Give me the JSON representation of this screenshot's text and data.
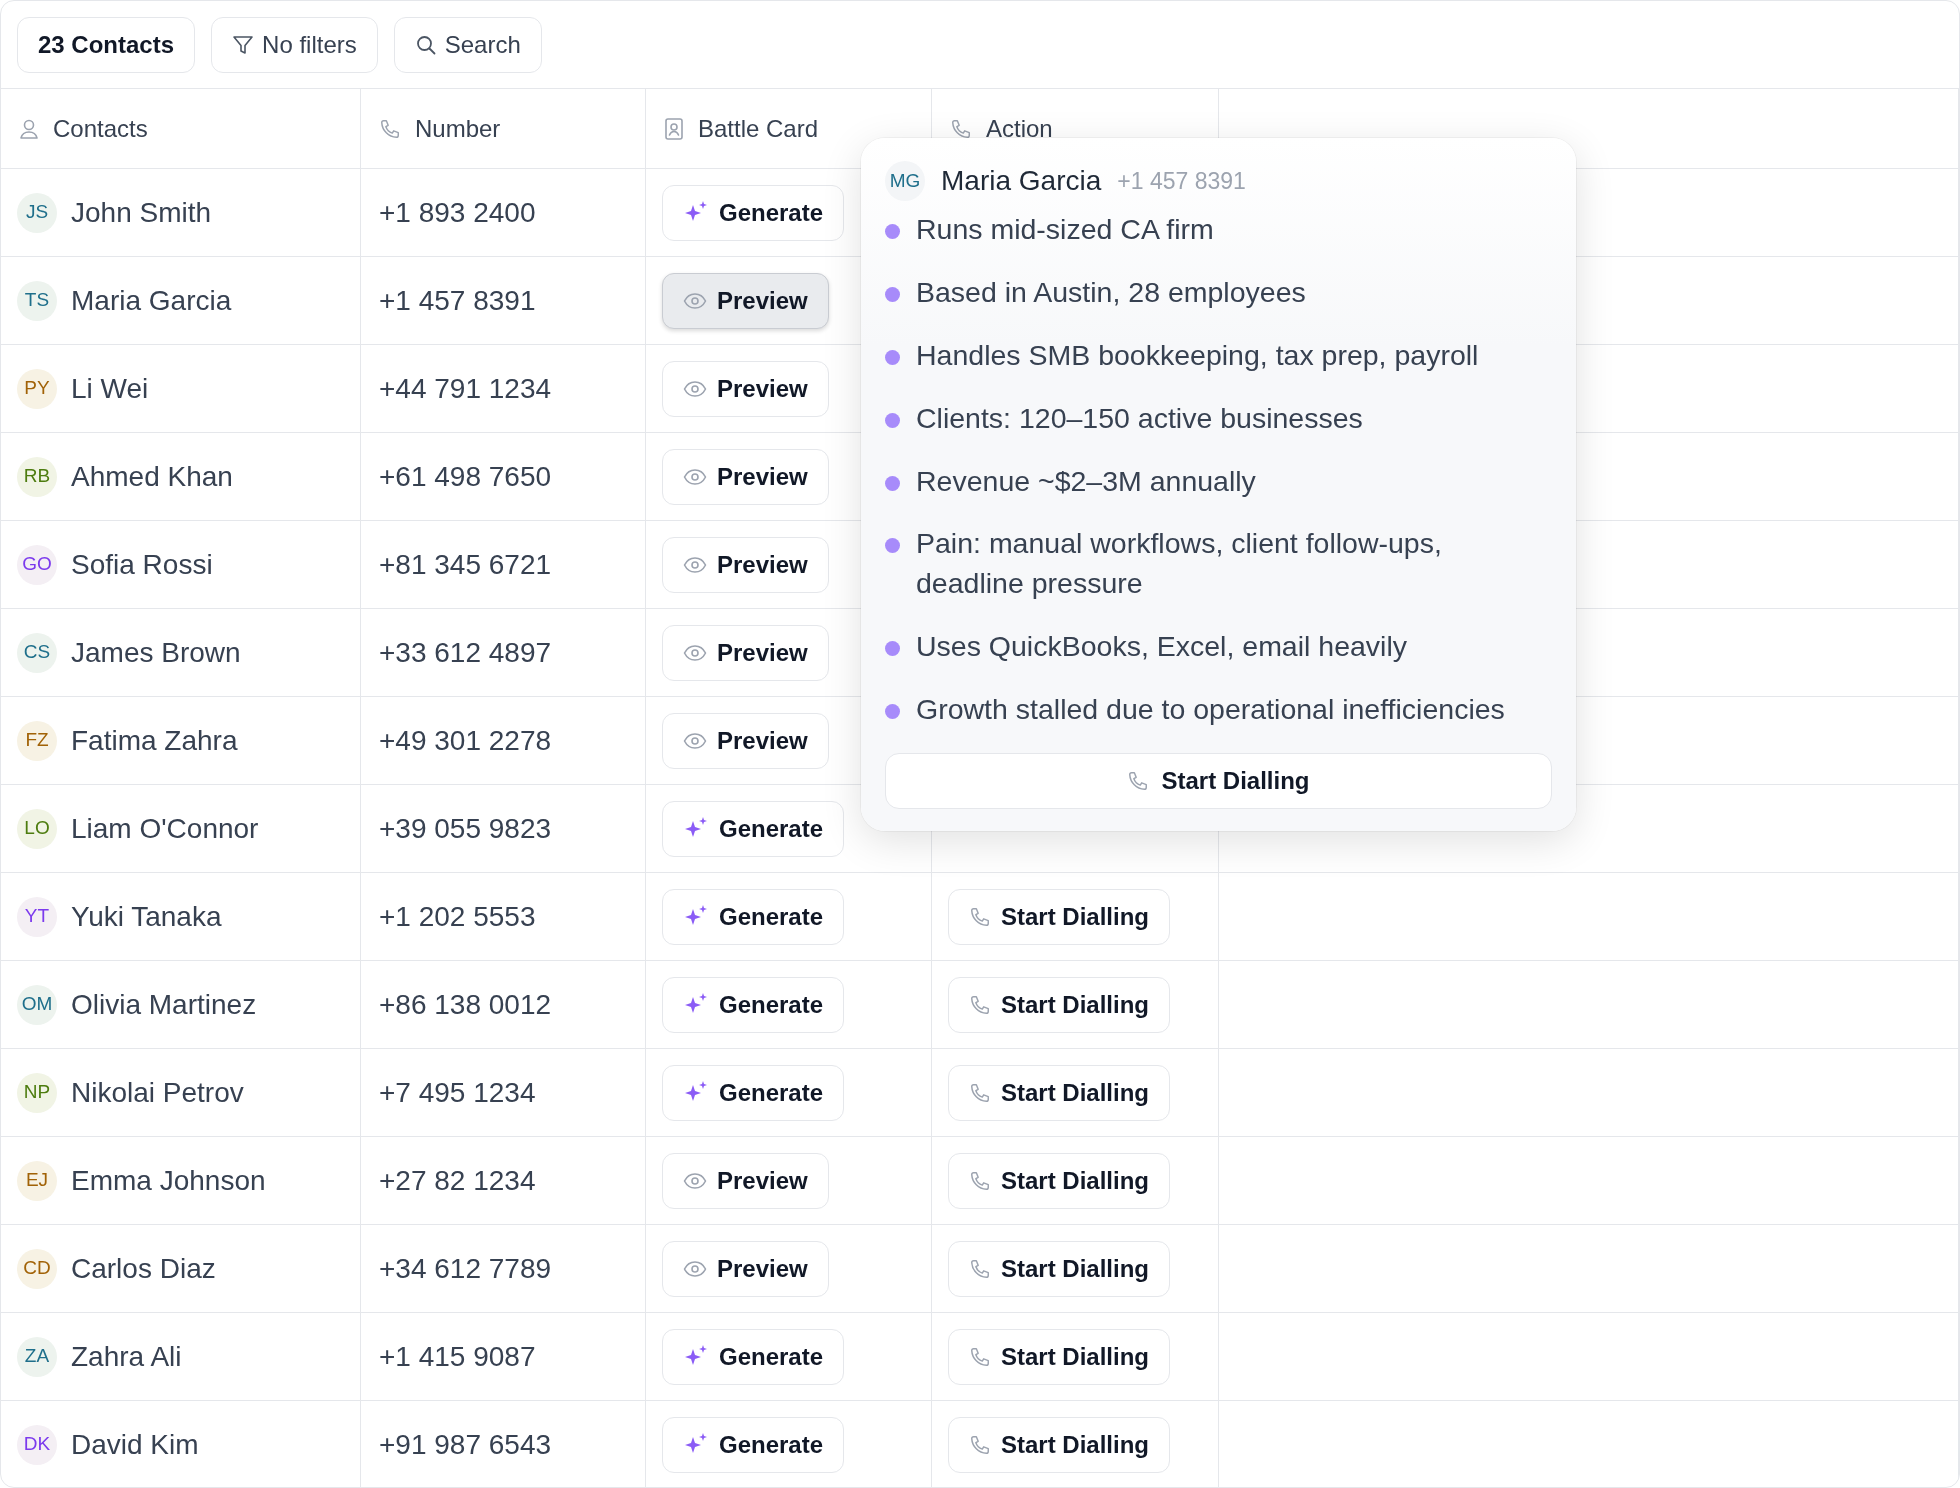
{
  "toolbar": {
    "count": "23 Contacts",
    "filters": "No filters",
    "search": "Search"
  },
  "table": {
    "columns": [
      {
        "label": "Contacts",
        "kind": "person"
      },
      {
        "label": "Number",
        "kind": "phone"
      },
      {
        "label": "Battle Card",
        "kind": "card"
      },
      {
        "label": "Action",
        "kind": "phone"
      }
    ],
    "rows": [
      {
        "initials": "JS",
        "color": "#1f6f8b",
        "name": "John Smith",
        "number": "+1 893 2400",
        "battle_card": {
          "label": "Generate",
          "kind": "generate",
          "selected": false
        }
      },
      {
        "initials": "TS",
        "color": "#1f6f8b",
        "name": "Maria Garcia",
        "number": "+1 457 8391",
        "battle_card": {
          "label": "Preview",
          "kind": "preview",
          "selected": true
        }
      },
      {
        "initials": "PY",
        "color": "#a16207",
        "name": "Li Wei",
        "number": "+44 791 1234",
        "battle_card": {
          "label": "Preview",
          "kind": "preview",
          "selected": false
        }
      },
      {
        "initials": "RB",
        "color": "#4d7c0f",
        "name": "Ahmed Khan",
        "number": "+61 498 7650",
        "battle_card": {
          "label": "Preview",
          "kind": "preview",
          "selected": false
        }
      },
      {
        "initials": "GO",
        "color": "#7c3aed",
        "name": "Sofia Rossi",
        "number": "+81 345 6721",
        "battle_card": {
          "label": "Preview",
          "kind": "preview",
          "selected": false
        }
      },
      {
        "initials": "CS",
        "color": "#1f6f8b",
        "name": "James Brown",
        "number": "+33 612 4897",
        "battle_card": {
          "label": "Preview",
          "kind": "preview",
          "selected": false
        }
      },
      {
        "initials": "FZ",
        "color": "#a16207",
        "name": "Fatima Zahra",
        "number": "+49 301 2278",
        "battle_card": {
          "label": "Preview",
          "kind": "preview",
          "selected": false
        }
      },
      {
        "initials": "LO",
        "color": "#4d7c0f",
        "name": "Liam O'Connor",
        "number": "+39 055 9823",
        "battle_card": {
          "label": "Generate",
          "kind": "generate",
          "selected": false
        }
      },
      {
        "initials": "YT",
        "color": "#7c3aed",
        "name": "Yuki Tanaka",
        "number": "+1 202 5553",
        "battle_card": {
          "label": "Generate",
          "kind": "generate",
          "selected": false
        },
        "action": "Start Dialling"
      },
      {
        "initials": "OM",
        "color": "#1f6f8b",
        "name": "Olivia Martinez",
        "number": "+86 138 0012",
        "battle_card": {
          "label": "Generate",
          "kind": "generate",
          "selected": false
        },
        "action": "Start Dialling"
      },
      {
        "initials": "NP",
        "color": "#4d7c0f",
        "name": "Nikolai Petrov",
        "number": "+7 495 1234",
        "battle_card": {
          "label": "Generate",
          "kind": "generate",
          "selected": false
        },
        "action": "Start Dialling"
      },
      {
        "initials": "EJ",
        "color": "#a16207",
        "name": "Emma Johnson",
        "number": "+27 82 1234",
        "battle_card": {
          "label": "Preview",
          "kind": "preview",
          "selected": false
        },
        "action": "Start Dialling"
      },
      {
        "initials": "CD",
        "color": "#a16207",
        "name": "Carlos Diaz",
        "number": "+34 612 7789",
        "battle_card": {
          "label": "Preview",
          "kind": "preview",
          "selected": false
        },
        "action": "Start Dialling"
      },
      {
        "initials": "ZA",
        "color": "#1f6f8b",
        "name": "Zahra Ali",
        "number": "+1 415 9087",
        "battle_card": {
          "label": "Generate",
          "kind": "generate",
          "selected": false
        },
        "action": "Start Dialling"
      },
      {
        "initials": "DK",
        "color": "#7c3aed",
        "name": "David Kim",
        "number": "+91 987 6543",
        "battle_card": {
          "label": "Generate",
          "kind": "generate",
          "selected": false
        },
        "action": "Start Dialling"
      }
    ]
  },
  "popover": {
    "initials": "MG",
    "name": "Maria Garcia",
    "number": "+1 457 8391",
    "points": [
      "Runs mid-sized CA firm",
      "Based in Austin, 28 employees",
      "Handles SMB bookkeeping, tax prep, payroll",
      "Clients: 120–150 active businesses",
      "Revenue ~$2–3M annually",
      "Pain: manual workflows, client follow-ups, deadline pressure",
      "Uses QuickBooks, Excel, email heavily",
      "Growth stalled due to operational inefficiencies"
    ],
    "button": "Start Dialling"
  }
}
